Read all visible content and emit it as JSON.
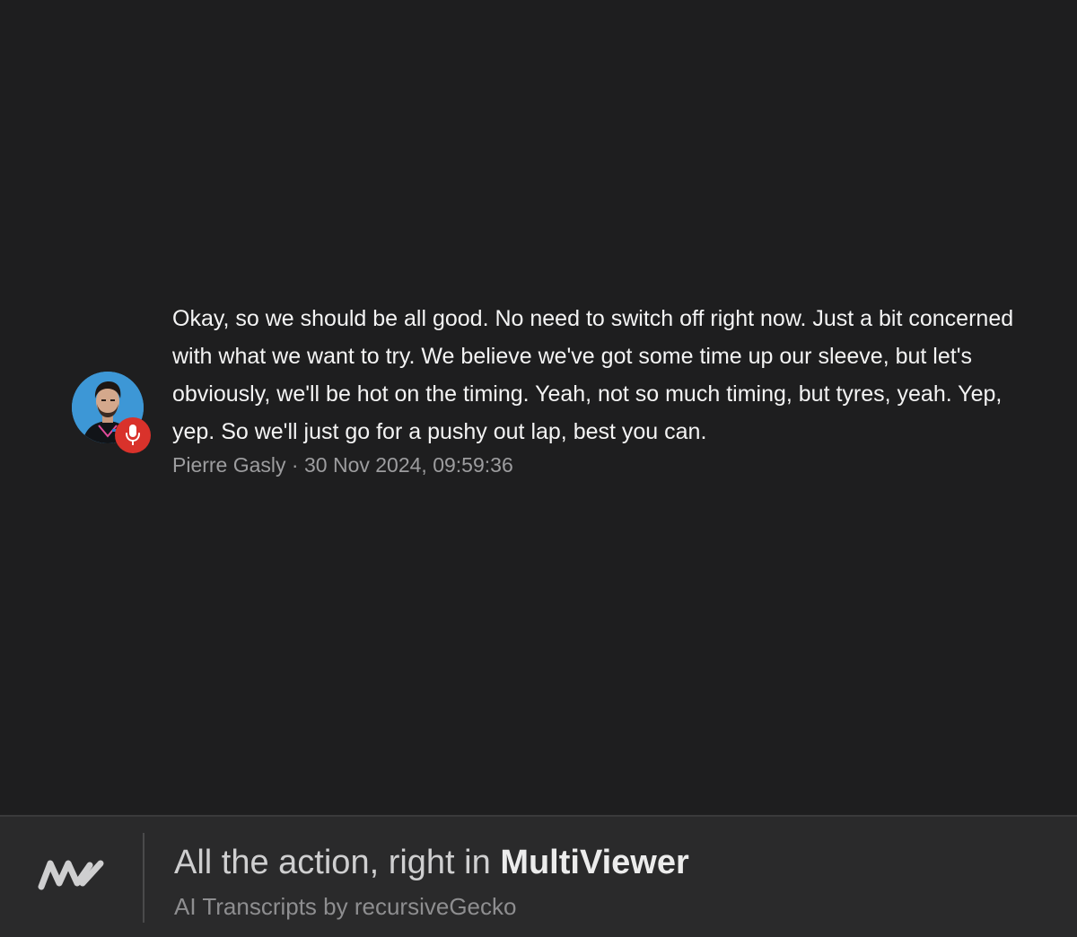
{
  "message": {
    "text": "Okay, so we should be all good. No need to switch off right now. Just a bit concerned with what we want to try. We believe we've got some time up our sleeve, but let's obviously, we'll be hot on the timing. Yeah, not so much timing, but tyres, yeah. Yep, yep. So we'll just go for a pushy out lap, best you can.",
    "author": "Pierre Gasly",
    "separator": " · ",
    "timestamp": "30 Nov 2024, 09:59:36",
    "avatar_icon": "driver-avatar",
    "badge_icon": "microphone-icon",
    "avatar_color": "#3d97d6",
    "badge_color": "#d9322b"
  },
  "footer": {
    "title_prefix": "All the action, right in ",
    "title_brand": "MultiViewer",
    "subtitle": "AI Transcripts by recursiveGecko",
    "logo_icon": "multiviewer-logo"
  }
}
